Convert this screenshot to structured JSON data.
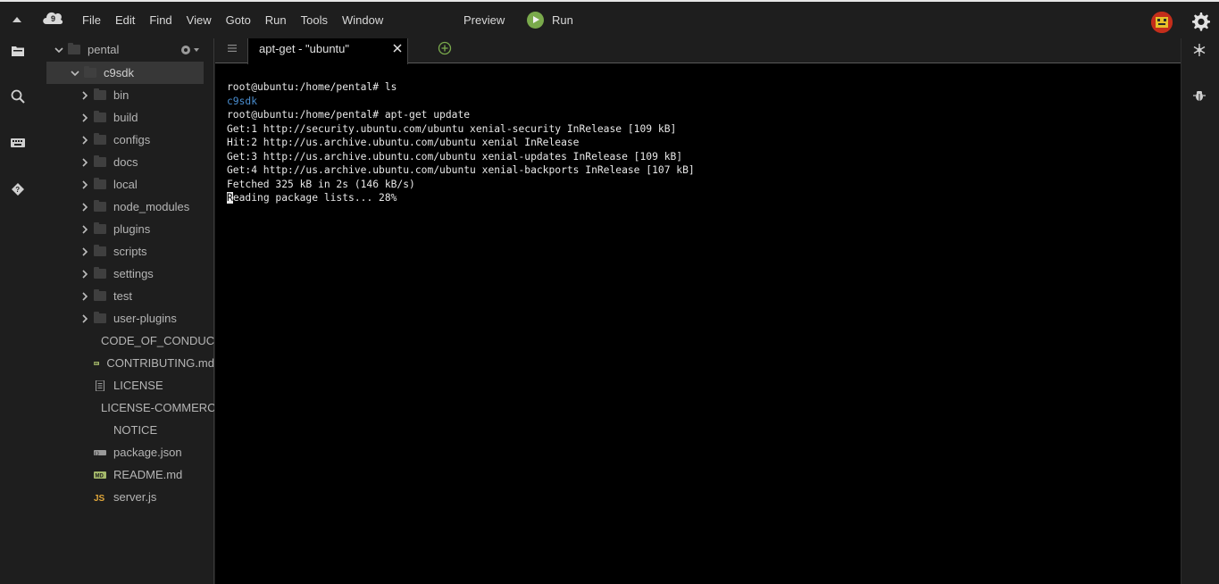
{
  "menubar": {
    "items": [
      "File",
      "Edit",
      "Find",
      "View",
      "Goto",
      "Run",
      "Tools",
      "Window"
    ],
    "preview_label": "Preview",
    "run_label": "Run"
  },
  "tree": {
    "root": "pental",
    "project": "c9sdk",
    "folders": [
      "bin",
      "build",
      "configs",
      "docs",
      "local",
      "node_modules",
      "plugins",
      "scripts",
      "settings",
      "test",
      "user-plugins"
    ],
    "files": [
      {
        "name": "CODE_OF_CONDUCT.md",
        "icon": "markdown-icon"
      },
      {
        "name": "CONTRIBUTING.md",
        "icon": "markdown-icon"
      },
      {
        "name": "LICENSE",
        "icon": "document-icon"
      },
      {
        "name": "LICENSE-COMMERCIAL",
        "icon": "document-icon"
      },
      {
        "name": "NOTICE",
        "icon": "none"
      },
      {
        "name": "package.json",
        "icon": "json-icon"
      },
      {
        "name": "README.md",
        "icon": "markdown-icon"
      },
      {
        "name": "server.js",
        "icon": "js-icon"
      }
    ]
  },
  "editor": {
    "tab_title": "apt-get - \"ubuntu\""
  },
  "terminal": {
    "lines": [
      {
        "text": "root@ubuntu:/home/pental# ls",
        "kind": "normal"
      },
      {
        "text": "c9sdk",
        "kind": "dir"
      },
      {
        "text": "root@ubuntu:/home/pental# apt-get update",
        "kind": "normal"
      },
      {
        "text": "Get:1 http://security.ubuntu.com/ubuntu xenial-security InRelease [109 kB]",
        "kind": "normal"
      },
      {
        "text": "Hit:2 http://us.archive.ubuntu.com/ubuntu xenial InRelease",
        "kind": "normal"
      },
      {
        "text": "Get:3 http://us.archive.ubuntu.com/ubuntu xenial-updates InRelease [109 kB]",
        "kind": "normal"
      },
      {
        "text": "Get:4 http://us.archive.ubuntu.com/ubuntu xenial-backports InRelease [107 kB]",
        "kind": "normal"
      },
      {
        "text": "Fetched 325 kB in 2s (146 kB/s)",
        "kind": "normal"
      },
      {
        "text": "Reading package lists... 28%",
        "kind": "cursor"
      }
    ]
  },
  "colors": {
    "accent_green": "#7aaa4c",
    "directory_blue": "#4a8ed0",
    "background": "#1e1e1e",
    "terminal_bg": "#000000"
  }
}
